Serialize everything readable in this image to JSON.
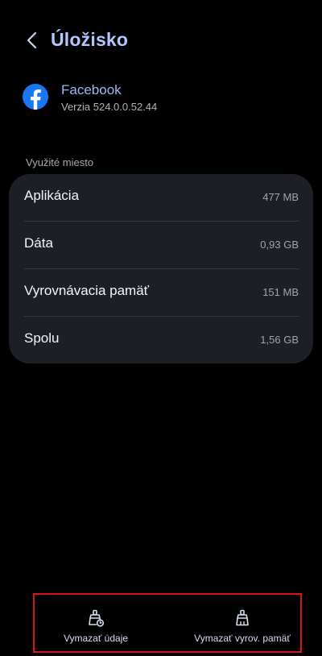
{
  "header": {
    "title": "Úložisko",
    "back_icon": "chevron-left-icon"
  },
  "app": {
    "name": "Facebook",
    "version": "Verzia 524.0.0.52.44",
    "icon": "facebook-logo-icon",
    "icon_color": "#1877f2"
  },
  "usage": {
    "section_label": "Využité miesto",
    "rows": [
      {
        "label": "Aplikácia",
        "value": "477 MB"
      },
      {
        "label": "Dáta",
        "value": "0,93 GB"
      },
      {
        "label": "Vyrovnávacia pamäť",
        "value": "151 MB"
      },
      {
        "label": "Spolu",
        "value": "1,56 GB"
      }
    ]
  },
  "actions": {
    "clear_data_label": "Vymazať údaje",
    "clear_data_icon": "clear-data-icon",
    "clear_cache_label": "Vymazať vyrov. pamäť",
    "clear_cache_icon": "broom-icon"
  },
  "colors": {
    "title": "#b0c8ff",
    "card_bg": "#1c1f26",
    "highlight_border": "#d8121f"
  }
}
